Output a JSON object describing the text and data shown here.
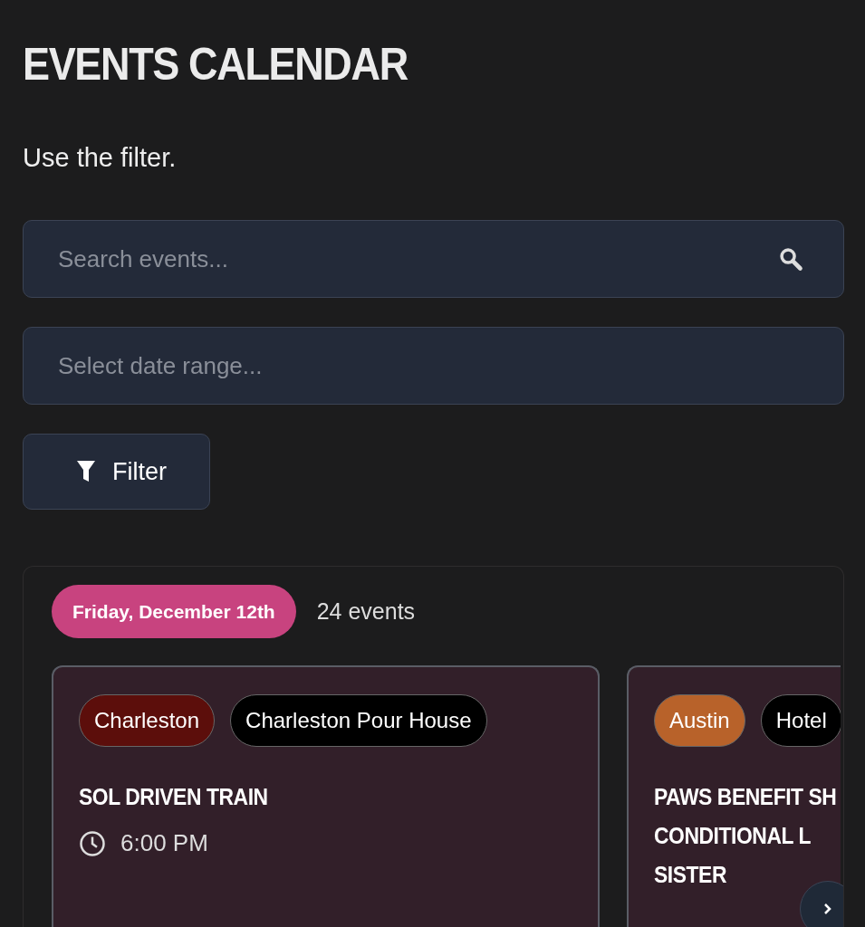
{
  "title": "EVENTS CALENDAR",
  "subtitle": "Use the filter.",
  "search": {
    "placeholder": "Search events..."
  },
  "date_range": {
    "placeholder": "Select date range..."
  },
  "filter_button": {
    "label": "Filter"
  },
  "day_group": {
    "date": "Friday, December 12th",
    "count": "24 events",
    "events": [
      {
        "tags": [
          {
            "label": "Charleston",
            "color": "#5c0e0b"
          },
          {
            "label": "Charleston Pour House",
            "color": "#000000"
          }
        ],
        "title_lines": [
          "SOL DRIVEN TRAIN"
        ],
        "time": "6:00 PM"
      },
      {
        "tags": [
          {
            "label": "Austin",
            "color": "#b8622a"
          },
          {
            "label": "Hotel",
            "color": "#000000"
          }
        ],
        "title_lines": [
          "PAWS BENEFIT SH",
          "CONDITIONAL L",
          "SISTER"
        ]
      }
    ]
  }
}
